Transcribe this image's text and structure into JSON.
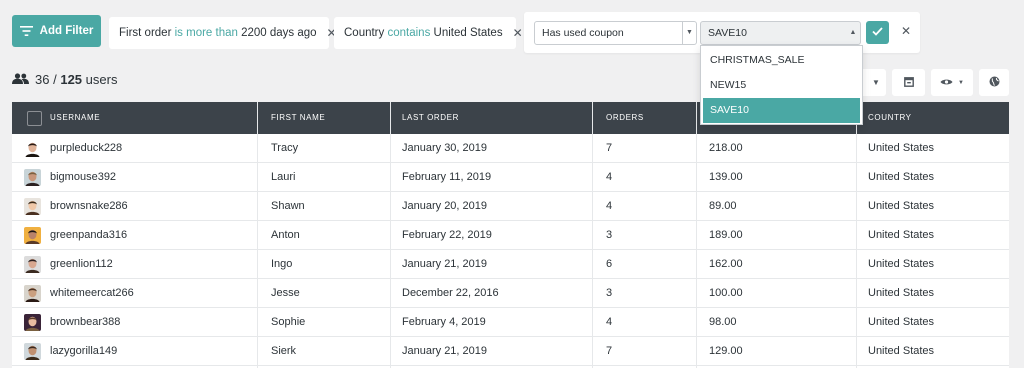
{
  "add_filter": {
    "label": "Add Filter",
    "icon": "filter-lines-icon"
  },
  "filters": [
    {
      "pre": "First order",
      "op": "is more than",
      "post": "2200 days ago"
    },
    {
      "pre": "Country",
      "op": "contains",
      "post": "United States"
    }
  ],
  "editor": {
    "field_value": "Has used coupon",
    "coupon_value": "SAVE10",
    "options": [
      "CHRISTMAS_SALE",
      "NEW15",
      "SAVE10"
    ],
    "active_option": "SAVE10"
  },
  "count": {
    "shown": "36",
    "separator": "/",
    "total": "125",
    "unit": "users"
  },
  "table": {
    "columns": {
      "username": "USERNAME",
      "first_name": "FIRST NAME",
      "last_order": "LAST ORDER",
      "orders": "ORDERS",
      "country": "COUNTRY"
    },
    "rows": [
      {
        "username": "purpleduck228",
        "first_name": "Tracy",
        "last_order": "January 30, 2019",
        "orders": "7",
        "total": "218.00",
        "country": "United States"
      },
      {
        "username": "bigmouse392",
        "first_name": "Lauri",
        "last_order": "February 11, 2019",
        "orders": "4",
        "total": "139.00",
        "country": "United States"
      },
      {
        "username": "brownsnake286",
        "first_name": "Shawn",
        "last_order": "January 20, 2019",
        "orders": "4",
        "total": "89.00",
        "country": "United States"
      },
      {
        "username": "greenpanda316",
        "first_name": "Anton",
        "last_order": "February 22, 2019",
        "orders": "3",
        "total": "189.00",
        "country": "United States"
      },
      {
        "username": "greenlion112",
        "first_name": "Ingo",
        "last_order": "January 21, 2019",
        "orders": "6",
        "total": "162.00",
        "country": "United States"
      },
      {
        "username": "whitemeercat266",
        "first_name": "Jesse",
        "last_order": "December 22, 2016",
        "orders": "3",
        "total": "100.00",
        "country": "United States"
      },
      {
        "username": "brownbear388",
        "first_name": "Sophie",
        "last_order": "February 4, 2019",
        "orders": "4",
        "total": "98.00",
        "country": "United States"
      },
      {
        "username": "lazygorilla149",
        "first_name": "Sierk",
        "last_order": "January 21, 2019",
        "orders": "7",
        "total": "129.00",
        "country": "United States"
      }
    ]
  },
  "colors": {
    "accent": "#4aa8a4",
    "header": "#3c434a",
    "background": "#f0f0f1"
  }
}
